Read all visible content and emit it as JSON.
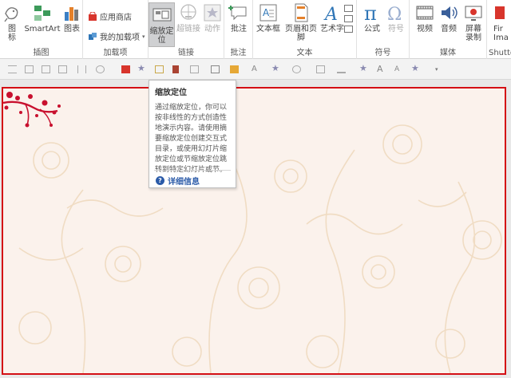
{
  "ribbon": {
    "groups": {
      "illustrations": {
        "label": "插图",
        "icons_label": "图\n标",
        "smartart_label": "SmartArt",
        "chart_label": "图表"
      },
      "addins": {
        "label": "加载项",
        "store_label": "应用商店",
        "my_addins_label": "我的加载项"
      },
      "links": {
        "label": "链接",
        "zoom_label_line1": "缩放定",
        "zoom_label_line2": "位",
        "hyperlink_label": "超链接",
        "action_label": "动作"
      },
      "comments": {
        "label": "批注",
        "comment_label": "批注"
      },
      "text": {
        "label": "文本",
        "textbox_label": "文本框",
        "header_footer_label": "页眉和页脚",
        "wordart_label": "艺术字"
      },
      "symbols": {
        "label": "符号",
        "equation_label": "公式",
        "symbol_label": "符号"
      },
      "media": {
        "label": "媒体",
        "video_label": "视频",
        "audio_label": "音频",
        "screen_rec_line1": "屏幕",
        "screen_rec_line2": "录制"
      },
      "shutter": {
        "label": "Shutte",
        "line1": "Fir",
        "line2": "Ima"
      }
    }
  },
  "tooltip": {
    "title": "缩放定位",
    "body": "通过缩放定位，你可以按非线性的方式创造性地演示内容。请使用摘要缩放定位创建交互式目录，或使用幻灯片缩放定位或节缩放定位跳转到特定幻灯片或节。",
    "link": "详细信息"
  },
  "colors": {
    "slide_border": "#d40f15",
    "slide_bg": "#fbf2ec",
    "link": "#2a5aa8",
    "ornament": "#c8102e"
  },
  "icons": [
    "icons-icon",
    "smartart-icon",
    "chart-icon",
    "store-icon",
    "addins-icon",
    "zoom-icon",
    "hyperlink-icon",
    "action-icon",
    "comment-icon",
    "textbox-icon",
    "header-footer-icon",
    "wordart-icon",
    "equation-icon",
    "omega-icon",
    "video-icon",
    "audio-icon",
    "screen-recording-icon",
    "help-icon"
  ]
}
